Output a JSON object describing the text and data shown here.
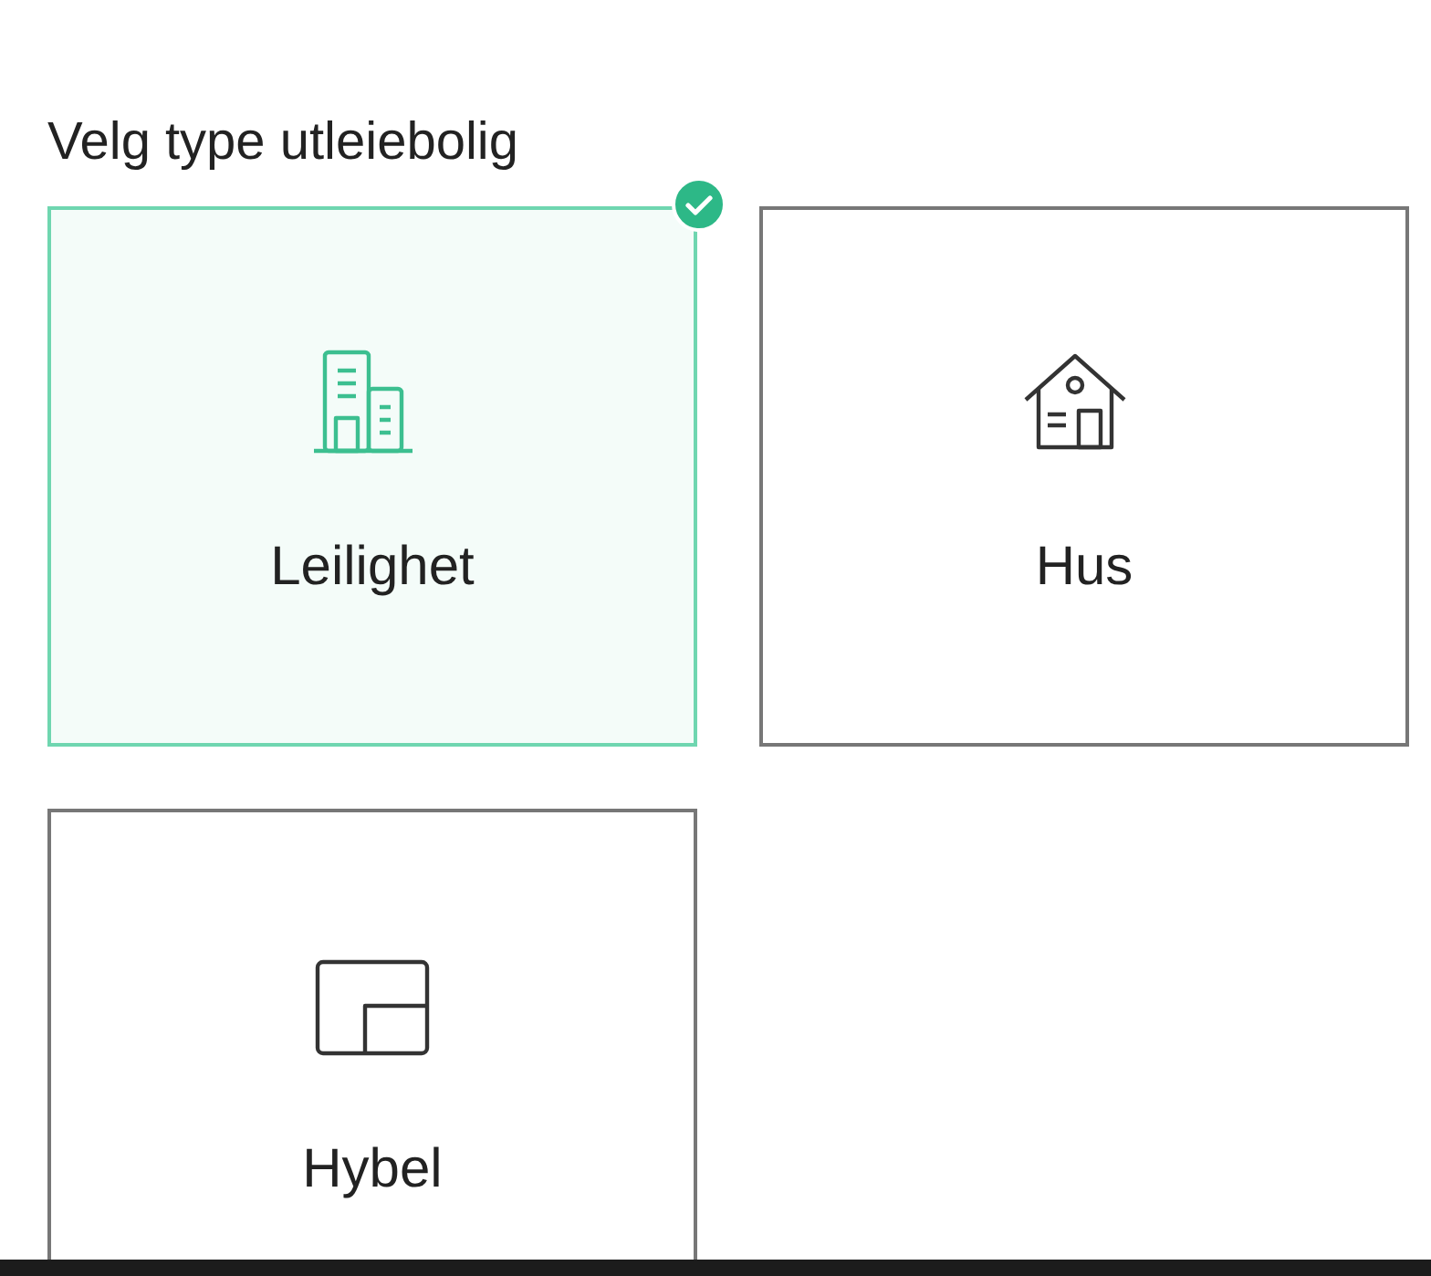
{
  "heading": "Velg type utleiebolig",
  "options": [
    {
      "label": "Leilighet",
      "kind": "apartment",
      "selected": true
    },
    {
      "label": "Hus",
      "kind": "house",
      "selected": false
    },
    {
      "label": "Hybel",
      "kind": "room",
      "selected": false
    }
  ]
}
